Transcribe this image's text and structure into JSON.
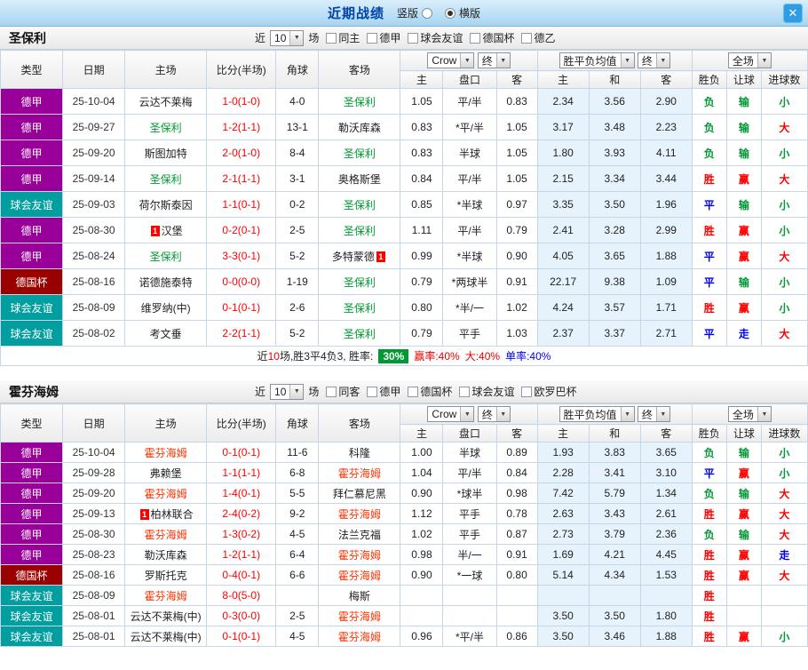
{
  "topbar": {
    "title": "近期战绩",
    "radio_vertical": "竖版",
    "radio_horizontal": "横版",
    "selected": "横版",
    "close_label": "✕"
  },
  "palette": {
    "win": "#ff0000",
    "draw": "#0000ff",
    "lose": "#009933",
    "score_red": "#ff0000",
    "league_bundesliga": "#990099",
    "league_friendly": "#009e9e",
    "league_german_cup": "#990000",
    "team_stpauli": "#009933",
    "team_hoffenheim": "#ff3300",
    "avg_bg": "#e7f3fc",
    "chip_bg": "#009933"
  },
  "table_header": {
    "type": "类型",
    "date": "日期",
    "home": "主场",
    "score": "比分(半场)",
    "corner": "角球",
    "away": "客场",
    "odds_book": "Crow",
    "odds_stage": "终",
    "avg_title": "胜平负均值",
    "avg_stage": "终",
    "scope": "全场",
    "sub_home": "主",
    "sub_handicap": "盘口",
    "sub_away": "客",
    "sub_avg_home": "主",
    "sub_avg_draw": "和",
    "sub_avg_away": "客",
    "sub_result": "胜负",
    "sub_handicap_result": "让球",
    "sub_goals": "进球数"
  },
  "sections": [
    {
      "team": "圣保利",
      "filter": {
        "near": "近",
        "count": "10",
        "unit": "场",
        "options": [
          {
            "label": "同主",
            "checked": false
          },
          {
            "label": "德甲",
            "checked": false
          },
          {
            "label": "球会友谊",
            "checked": false
          },
          {
            "label": "德国杯",
            "checked": false
          },
          {
            "label": "德乙",
            "checked": false
          }
        ]
      },
      "rows": [
        {
          "type": "德甲",
          "type_color": "#990099",
          "date": "25-10-04",
          "home": "云达不莱梅",
          "home_color": null,
          "home_badge": null,
          "home_badge_pos": null,
          "score": "1-0(1-0)",
          "corner": "4-0",
          "away": "圣保利",
          "away_color": "#009933",
          "away_badge": null,
          "away_badge_pos": null,
          "o1": "1.05",
          "handicap": "平/半",
          "o2": "0.83",
          "a1": "2.34",
          "a2": "3.56",
          "a3": "2.90",
          "res": "负",
          "res_c": "lose",
          "hcp": "输",
          "hcp_c": "lose",
          "goals": "小",
          "goals_c": "lose"
        },
        {
          "type": "德甲",
          "type_color": "#990099",
          "date": "25-09-27",
          "home": "圣保利",
          "home_color": "#009933",
          "home_badge": null,
          "home_badge_pos": null,
          "score": "1-2(1-1)",
          "corner": "13-1",
          "away": "勒沃库森",
          "away_color": null,
          "away_badge": null,
          "away_badge_pos": null,
          "o1": "0.83",
          "handicap": "*平/半",
          "o2": "1.05",
          "a1": "3.17",
          "a2": "3.48",
          "a3": "2.23",
          "res": "负",
          "res_c": "lose",
          "hcp": "输",
          "hcp_c": "lose",
          "goals": "大",
          "goals_c": "win"
        },
        {
          "type": "德甲",
          "type_color": "#990099",
          "date": "25-09-20",
          "home": "斯图加特",
          "home_color": null,
          "home_badge": null,
          "home_badge_pos": null,
          "score": "2-0(1-0)",
          "corner": "8-4",
          "away": "圣保利",
          "away_color": "#009933",
          "away_badge": null,
          "away_badge_pos": null,
          "o1": "0.83",
          "handicap": "半球",
          "o2": "1.05",
          "a1": "1.80",
          "a2": "3.93",
          "a3": "4.11",
          "res": "负",
          "res_c": "lose",
          "hcp": "输",
          "hcp_c": "lose",
          "goals": "小",
          "goals_c": "lose"
        },
        {
          "type": "德甲",
          "type_color": "#990099",
          "date": "25-09-14",
          "home": "圣保利",
          "home_color": "#009933",
          "home_badge": null,
          "home_badge_pos": null,
          "score": "2-1(1-1)",
          "corner": "3-1",
          "away": "奥格斯堡",
          "away_color": null,
          "away_badge": null,
          "away_badge_pos": null,
          "o1": "0.84",
          "handicap": "平/半",
          "o2": "1.05",
          "a1": "2.15",
          "a2": "3.34",
          "a3": "3.44",
          "res": "胜",
          "res_c": "win",
          "hcp": "赢",
          "hcp_c": "win",
          "goals": "大",
          "goals_c": "win"
        },
        {
          "type": "球会友谊",
          "type_color": "#009e9e",
          "date": "25-09-03",
          "home": "荷尔斯泰因",
          "home_color": null,
          "home_badge": null,
          "home_badge_pos": null,
          "score": "1-1(0-1)",
          "corner": "0-2",
          "away": "圣保利",
          "away_color": "#009933",
          "away_badge": null,
          "away_badge_pos": null,
          "o1": "0.85",
          "handicap": "*半球",
          "o2": "0.97",
          "a1": "3.35",
          "a2": "3.50",
          "a3": "1.96",
          "res": "平",
          "res_c": "draw",
          "hcp": "输",
          "hcp_c": "lose",
          "goals": "小",
          "goals_c": "lose"
        },
        {
          "type": "德甲",
          "type_color": "#990099",
          "date": "25-08-30",
          "home": "汉堡",
          "home_color": null,
          "home_badge": "1",
          "home_badge_pos": "before",
          "score": "0-2(0-1)",
          "corner": "2-5",
          "away": "圣保利",
          "away_color": "#009933",
          "away_badge": null,
          "away_badge_pos": null,
          "o1": "1.11",
          "handicap": "平/半",
          "o2": "0.79",
          "a1": "2.41",
          "a2": "3.28",
          "a3": "2.99",
          "res": "胜",
          "res_c": "win",
          "hcp": "赢",
          "hcp_c": "win",
          "goals": "小",
          "goals_c": "lose"
        },
        {
          "type": "德甲",
          "type_color": "#990099",
          "date": "25-08-24",
          "home": "圣保利",
          "home_color": "#009933",
          "home_badge": null,
          "home_badge_pos": null,
          "score": "3-3(0-1)",
          "corner": "5-2",
          "away": "多特蒙德",
          "away_color": null,
          "away_badge": "1",
          "away_badge_pos": "after",
          "o1": "0.99",
          "handicap": "*半球",
          "o2": "0.90",
          "a1": "4.05",
          "a2": "3.65",
          "a3": "1.88",
          "res": "平",
          "res_c": "draw",
          "hcp": "赢",
          "hcp_c": "win",
          "goals": "大",
          "goals_c": "win"
        },
        {
          "type": "德国杯",
          "type_color": "#990000",
          "date": "25-08-16",
          "home": "诺德施泰特",
          "home_color": null,
          "home_badge": null,
          "home_badge_pos": null,
          "score": "0-0(0-0)",
          "corner": "1-19",
          "away": "圣保利",
          "away_color": "#009933",
          "away_badge": null,
          "away_badge_pos": null,
          "o1": "0.79",
          "handicap": "*两球半",
          "o2": "0.91",
          "a1": "22.17",
          "a2": "9.38",
          "a3": "1.09",
          "res": "平",
          "res_c": "draw",
          "hcp": "输",
          "hcp_c": "lose",
          "goals": "小",
          "goals_c": "lose"
        },
        {
          "type": "球会友谊",
          "type_color": "#009e9e",
          "date": "25-08-09",
          "home": "维罗纳(中)",
          "home_color": null,
          "home_badge": null,
          "home_badge_pos": null,
          "score": "0-1(0-1)",
          "corner": "2-6",
          "away": "圣保利",
          "away_color": "#009933",
          "away_badge": null,
          "away_badge_pos": null,
          "o1": "0.80",
          "handicap": "*半/一",
          "o2": "1.02",
          "a1": "4.24",
          "a2": "3.57",
          "a3": "1.71",
          "res": "胜",
          "res_c": "win",
          "hcp": "赢",
          "hcp_c": "win",
          "goals": "小",
          "goals_c": "lose"
        },
        {
          "type": "球会友谊",
          "type_color": "#009e9e",
          "date": "25-08-02",
          "home": "考文垂",
          "home_color": null,
          "home_badge": null,
          "home_badge_pos": null,
          "score": "2-2(1-1)",
          "corner": "5-2",
          "away": "圣保利",
          "away_color": "#009933",
          "away_badge": null,
          "away_badge_pos": null,
          "o1": "0.79",
          "handicap": "平手",
          "o2": "1.03",
          "a1": "2.37",
          "a2": "3.37",
          "a3": "2.71",
          "res": "平",
          "res_c": "draw",
          "hcp": "走",
          "hcp_c": "draw",
          "goals": "大",
          "goals_c": "win"
        }
      ],
      "summary": {
        "prefix": "近",
        "count": "10",
        "middle": "场,胜3平4负3, 胜率:",
        "rate_chip": "30%",
        "win_rate": "赢率:40%",
        "big_rate": "大:40%",
        "odd_rate": "单率:40%"
      }
    },
    {
      "team": "霍芬海姆",
      "filter": {
        "near": "近",
        "count": "10",
        "unit": "场",
        "options": [
          {
            "label": "同客",
            "checked": false
          },
          {
            "label": "德甲",
            "checked": false
          },
          {
            "label": "德国杯",
            "checked": false
          },
          {
            "label": "球会友谊",
            "checked": false
          },
          {
            "label": "欧罗巴杯",
            "checked": false
          }
        ]
      },
      "rows": [
        {
          "type": "德甲",
          "type_color": "#990099",
          "date": "25-10-04",
          "home": "霍芬海姆",
          "home_color": "#ff3300",
          "home_badge": null,
          "home_badge_pos": null,
          "score": "0-1(0-1)",
          "corner": "11-6",
          "away": "科隆",
          "away_color": null,
          "away_badge": null,
          "away_badge_pos": null,
          "o1": "1.00",
          "handicap": "半球",
          "o2": "0.89",
          "a1": "1.93",
          "a2": "3.83",
          "a3": "3.65",
          "res": "负",
          "res_c": "lose",
          "hcp": "输",
          "hcp_c": "lose",
          "goals": "小",
          "goals_c": "lose"
        },
        {
          "type": "德甲",
          "type_color": "#990099",
          "date": "25-09-28",
          "home": "弗赖堡",
          "home_color": null,
          "home_badge": null,
          "home_badge_pos": null,
          "score": "1-1(1-1)",
          "corner": "6-8",
          "away": "霍芬海姆",
          "away_color": "#ff3300",
          "away_badge": null,
          "away_badge_pos": null,
          "o1": "1.04",
          "handicap": "平/半",
          "o2": "0.84",
          "a1": "2.28",
          "a2": "3.41",
          "a3": "3.10",
          "res": "平",
          "res_c": "draw",
          "hcp": "赢",
          "hcp_c": "win",
          "goals": "小",
          "goals_c": "lose"
        },
        {
          "type": "德甲",
          "type_color": "#990099",
          "date": "25-09-20",
          "home": "霍芬海姆",
          "home_color": "#ff3300",
          "home_badge": null,
          "home_badge_pos": null,
          "score": "1-4(0-1)",
          "corner": "5-5",
          "away": "拜仁慕尼黑",
          "away_color": null,
          "away_badge": null,
          "away_badge_pos": null,
          "o1": "0.90",
          "handicap": "*球半",
          "o2": "0.98",
          "a1": "7.42",
          "a2": "5.79",
          "a3": "1.34",
          "res": "负",
          "res_c": "lose",
          "hcp": "输",
          "hcp_c": "lose",
          "goals": "大",
          "goals_c": "win"
        },
        {
          "type": "德甲",
          "type_color": "#990099",
          "date": "25-09-13",
          "home": "柏林联合",
          "home_color": null,
          "home_badge": "1",
          "home_badge_pos": "before",
          "score": "2-4(0-2)",
          "corner": "9-2",
          "away": "霍芬海姆",
          "away_color": "#ff3300",
          "away_badge": null,
          "away_badge_pos": null,
          "o1": "1.12",
          "handicap": "平手",
          "o2": "0.78",
          "a1": "2.63",
          "a2": "3.43",
          "a3": "2.61",
          "res": "胜",
          "res_c": "win",
          "hcp": "赢",
          "hcp_c": "win",
          "goals": "大",
          "goals_c": "win"
        },
        {
          "type": "德甲",
          "type_color": "#990099",
          "date": "25-08-30",
          "home": "霍芬海姆",
          "home_color": "#ff3300",
          "home_badge": null,
          "home_badge_pos": null,
          "score": "1-3(0-2)",
          "corner": "4-5",
          "away": "法兰克福",
          "away_color": null,
          "away_badge": null,
          "away_badge_pos": null,
          "o1": "1.02",
          "handicap": "平手",
          "o2": "0.87",
          "a1": "2.73",
          "a2": "3.79",
          "a3": "2.36",
          "res": "负",
          "res_c": "lose",
          "hcp": "输",
          "hcp_c": "lose",
          "goals": "大",
          "goals_c": "win"
        },
        {
          "type": "德甲",
          "type_color": "#990099",
          "date": "25-08-23",
          "home": "勒沃库森",
          "home_color": null,
          "home_badge": null,
          "home_badge_pos": null,
          "score": "1-2(1-1)",
          "corner": "6-4",
          "away": "霍芬海姆",
          "away_color": "#ff3300",
          "away_badge": null,
          "away_badge_pos": null,
          "o1": "0.98",
          "handicap": "半/一",
          "o2": "0.91",
          "a1": "1.69",
          "a2": "4.21",
          "a3": "4.45",
          "res": "胜",
          "res_c": "win",
          "hcp": "赢",
          "hcp_c": "win",
          "goals": "走",
          "goals_c": "draw"
        },
        {
          "type": "德国杯",
          "type_color": "#990000",
          "date": "25-08-16",
          "home": "罗斯托克",
          "home_color": null,
          "home_badge": null,
          "home_badge_pos": null,
          "score": "0-4(0-1)",
          "corner": "6-6",
          "away": "霍芬海姆",
          "away_color": "#ff3300",
          "away_badge": null,
          "away_badge_pos": null,
          "o1": "0.90",
          "handicap": "*一球",
          "o2": "0.80",
          "a1": "5.14",
          "a2": "4.34",
          "a3": "1.53",
          "res": "胜",
          "res_c": "win",
          "hcp": "赢",
          "hcp_c": "win",
          "goals": "大",
          "goals_c": "win"
        },
        {
          "type": "球会友谊",
          "type_color": "#009e9e",
          "date": "25-08-09",
          "home": "霍芬海姆",
          "home_color": "#ff3300",
          "home_badge": null,
          "home_badge_pos": null,
          "score": "8-0(5-0)",
          "corner": "",
          "away": "梅斯",
          "away_color": null,
          "away_badge": null,
          "away_badge_pos": null,
          "o1": "",
          "handicap": "",
          "o2": "",
          "a1": "",
          "a2": "",
          "a3": "",
          "res": "胜",
          "res_c": "win",
          "hcp": "",
          "hcp_c": null,
          "goals": "",
          "goals_c": null
        },
        {
          "type": "球会友谊",
          "type_color": "#009e9e",
          "date": "25-08-01",
          "home": "云达不莱梅(中)",
          "home_color": null,
          "home_badge": null,
          "home_badge_pos": null,
          "score": "0-3(0-0)",
          "corner": "2-5",
          "away": "霍芬海姆",
          "away_color": "#ff3300",
          "away_badge": null,
          "away_badge_pos": null,
          "o1": "",
          "handicap": "",
          "o2": "",
          "a1": "3.50",
          "a2": "3.50",
          "a3": "1.80",
          "res": "胜",
          "res_c": "win",
          "hcp": "",
          "hcp_c": null,
          "goals": "",
          "goals_c": null
        },
        {
          "type": "球会友谊",
          "type_color": "#009e9e",
          "date": "25-08-01",
          "home": "云达不莱梅(中)",
          "home_color": null,
          "home_badge": null,
          "home_badge_pos": null,
          "score": "0-1(0-1)",
          "corner": "4-5",
          "away": "霍芬海姆",
          "away_color": "#ff3300",
          "away_badge": null,
          "away_badge_pos": null,
          "o1": "0.96",
          "handicap": "*平/半",
          "o2": "0.86",
          "a1": "3.50",
          "a2": "3.46",
          "a3": "1.88",
          "res": "胜",
          "res_c": "win",
          "hcp": "赢",
          "hcp_c": "win",
          "goals": "小",
          "goals_c": "lose"
        }
      ]
    }
  ]
}
